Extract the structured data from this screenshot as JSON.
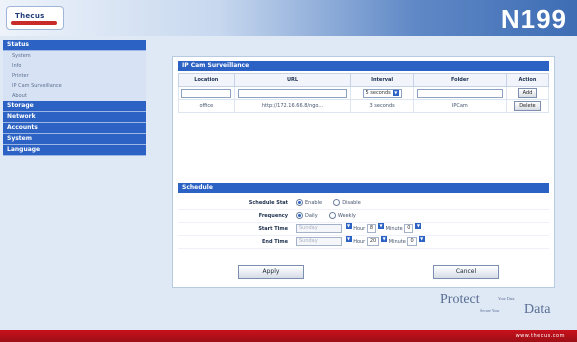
{
  "header": {
    "logo_text": "Thecus",
    "model": "N199"
  },
  "sidebar": {
    "groups": [
      {
        "label": "Status",
        "items": [
          "System",
          "Info",
          "Printer",
          "IP Cam Surveillance",
          "About"
        ]
      },
      {
        "label": "Storage"
      },
      {
        "label": "Network"
      },
      {
        "label": "Accounts"
      },
      {
        "label": "System"
      },
      {
        "label": "Language"
      }
    ]
  },
  "ipcam": {
    "title": "IP Cam Surveillance",
    "columns": [
      "Location",
      "URL",
      "Interval",
      "Folder",
      "Action"
    ],
    "new_row": {
      "location": "",
      "url": "",
      "interval": "5 seconds",
      "folder": "",
      "action": "Add"
    },
    "rows": [
      {
        "location": "office",
        "url": "http://172.16.66.8/ngo...",
        "interval": "3 seconds",
        "folder": "IPCam",
        "action": "Delete"
      }
    ]
  },
  "schedule": {
    "title": "Schedule",
    "fields": {
      "schedule_stat": {
        "label": "Schedule Stat",
        "options": [
          "Enable",
          "Disable"
        ],
        "selected": "Enable"
      },
      "frequency": {
        "label": "Frequency",
        "options": [
          "Daily",
          "Weekly"
        ],
        "selected": "Daily"
      },
      "start_time": {
        "label": "Start Time",
        "day": "Sunday",
        "hour_label": "Hour",
        "hour": "8",
        "minute_label": "Minute",
        "minute": "0"
      },
      "end_time": {
        "label": "End Time",
        "day": "Sunday",
        "hour_label": "Hour",
        "hour": "20",
        "minute_label": "Minute",
        "minute": "0"
      }
    }
  },
  "actions": {
    "apply": "Apply",
    "cancel": "Cancel"
  },
  "footer": {
    "slogan_big1": "Protect",
    "slogan_small1": "Your Data",
    "slogan_small2": "Secure Your",
    "slogan_big2": "Data",
    "url": "www.thecus.com"
  },
  "colors": {
    "accent": "#2b62c4",
    "footer": "#c8101c"
  }
}
